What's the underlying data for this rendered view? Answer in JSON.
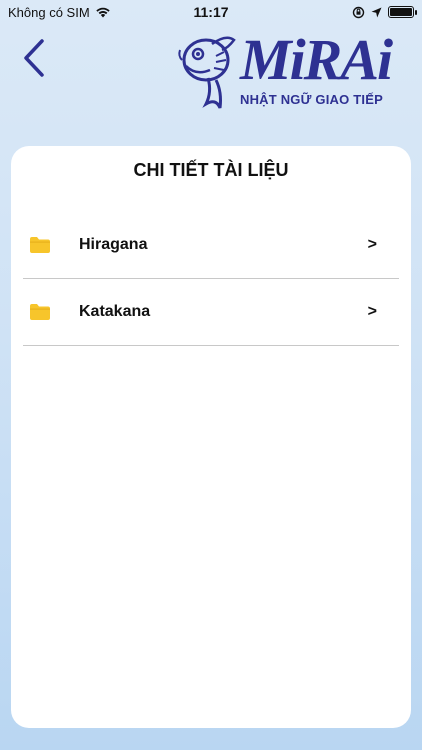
{
  "status_bar": {
    "carrier": "Không có SIM",
    "time": "11:17"
  },
  "header": {
    "back_icon": "chevron-left-icon",
    "logo": {
      "wordmark": "MiRAi",
      "tagline": "NHẬT NGỮ GIAO TIẾP",
      "color": "#2e3192"
    }
  },
  "card": {
    "title": "CHI TIẾT TÀI LIỆU",
    "items": [
      {
        "label": "Hiragana",
        "icon": "folder-icon",
        "chevron": ">"
      },
      {
        "label": "Katakana",
        "icon": "folder-icon",
        "chevron": ">"
      }
    ]
  },
  "colors": {
    "folder": "#f7c52b",
    "brand": "#2e3192",
    "background": "#cfe2f5"
  }
}
